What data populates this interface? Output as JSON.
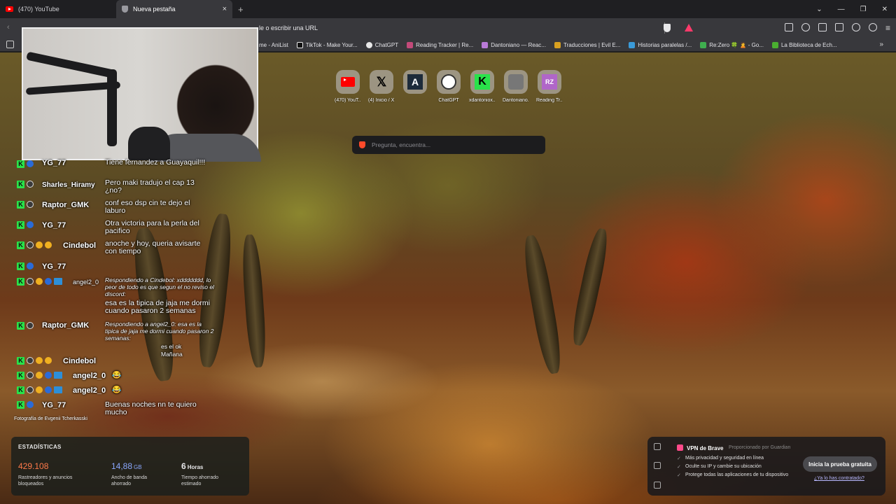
{
  "tabs": [
    {
      "label": "(470) YouTube"
    },
    {
      "label": "Nueva pestaña"
    }
  ],
  "new_tab": "+",
  "close_tab": "×",
  "omnibox": {
    "placeholder": "le o escribir una URL"
  },
  "bookmarks": [
    {
      "label": "me - AniList",
      "color": "#3b6fb6"
    },
    {
      "label": "TikTok - Make Your...",
      "color": "#111111"
    },
    {
      "label": "ChatGPT",
      "color": "#e8e8e8"
    },
    {
      "label": "Reading Tracker | Re...",
      "color": "#c34a7a"
    },
    {
      "label": "Dantoniano — Reac...",
      "color": "#b97ad8"
    },
    {
      "label": "Traducciones | Evil E...",
      "color": "#d8a020"
    },
    {
      "label": "Historias paralelas /...",
      "color": "#3a9ad8"
    },
    {
      "label": "Re:Zero 🍀 🙎 - Go...",
      "color": "#3fae4f"
    },
    {
      "label": "La Biblioteca de Ech...",
      "color": "#4aae30"
    }
  ],
  "shortcuts": [
    {
      "label": "(470) YouT...",
      "icon": "youtube-icon",
      "color": "#ff0000"
    },
    {
      "label": "(4) Inicio / X Home - Ani...",
      "icon": "x-icon",
      "color": "#000000"
    },
    {
      "label": "",
      "icon": "anilist-icon",
      "color": "#1d2b3a"
    },
    {
      "label": "ChatGPT",
      "icon": "chatgpt-icon",
      "color": "#ffffff"
    },
    {
      "label": "xdantoniox...",
      "icon": "kick-icon",
      "color": "#29e24a"
    },
    {
      "label": "Dantoniano...",
      "icon": "avatar-icon",
      "color": "#777777"
    },
    {
      "label": "Reading Tr...",
      "icon": "rz-icon",
      "color": "#b066c8"
    }
  ],
  "search": {
    "placeholder": "Pregunta, encuentra..."
  },
  "chat": [
    {
      "user": "YG_77",
      "text": "Tiene fernandez a Guayaquil!!!"
    },
    {
      "user": "Sharles_Hiramy",
      "text": "Pero maki tradujo el cap 13 ¿no?"
    },
    {
      "user": "Raptor_GMK",
      "text": "conf eso dsp cin te dejo el laburo"
    },
    {
      "user": "YG_77",
      "text": "Otra victoria para la perla del pacifico"
    },
    {
      "user": "Cindebol",
      "text": "anoche y hoy, queria avisarte con tiempo"
    },
    {
      "user": "YG_77",
      "text": ""
    },
    {
      "user": "angel2_0",
      "reply": "Respondiendo a Cindebol: xddddddd, lo peor de todo es que segun el no reviso el discord:",
      "text": "esa es la tipica de jaja me dormi cuando pasaron 2 semanas"
    },
    {
      "user": "Raptor_GMK",
      "reply": "Respondiendo a angel2_0: esa es la tipica de jaja me dormi cuando pasaron 2 semanas:",
      "text": "es el ok Mañana"
    },
    {
      "user": "Cindebol",
      "text": ""
    },
    {
      "user": "angel2_0",
      "text": "😂"
    },
    {
      "user": "angel2_0",
      "text": "😂"
    },
    {
      "user": "YG_77",
      "text": "Buenas noches nn te quiero mucho"
    }
  ],
  "photo_credit": "Fotografía de Evgenii Tcherkasski",
  "stats": {
    "title": "ESTADÍSTICAS",
    "items": [
      {
        "value": "429.108",
        "unit": "",
        "desc": "Rastreadores y anuncios bloqueados",
        "color": "#ff7a4a"
      },
      {
        "value": "14,88",
        "unit": "GB",
        "desc": "Ancho de banda ahorrado",
        "color": "#8aa8ff"
      },
      {
        "value": "6",
        "unit": "Horas",
        "desc": "Tiempo ahorrado estimado",
        "color": "#ffffff"
      }
    ]
  },
  "vpn": {
    "title": "VPN de Brave",
    "by": "Proporcionado por Guardian",
    "features": [
      "Más privacidad y seguridad en línea",
      "Oculte su IP y cambie su ubicación",
      "Protege todas las aplicaciones de tu dispositivo"
    ],
    "cta": "Inicia la prueba gratuita",
    "link": "¿Ya lo has contratado?"
  }
}
